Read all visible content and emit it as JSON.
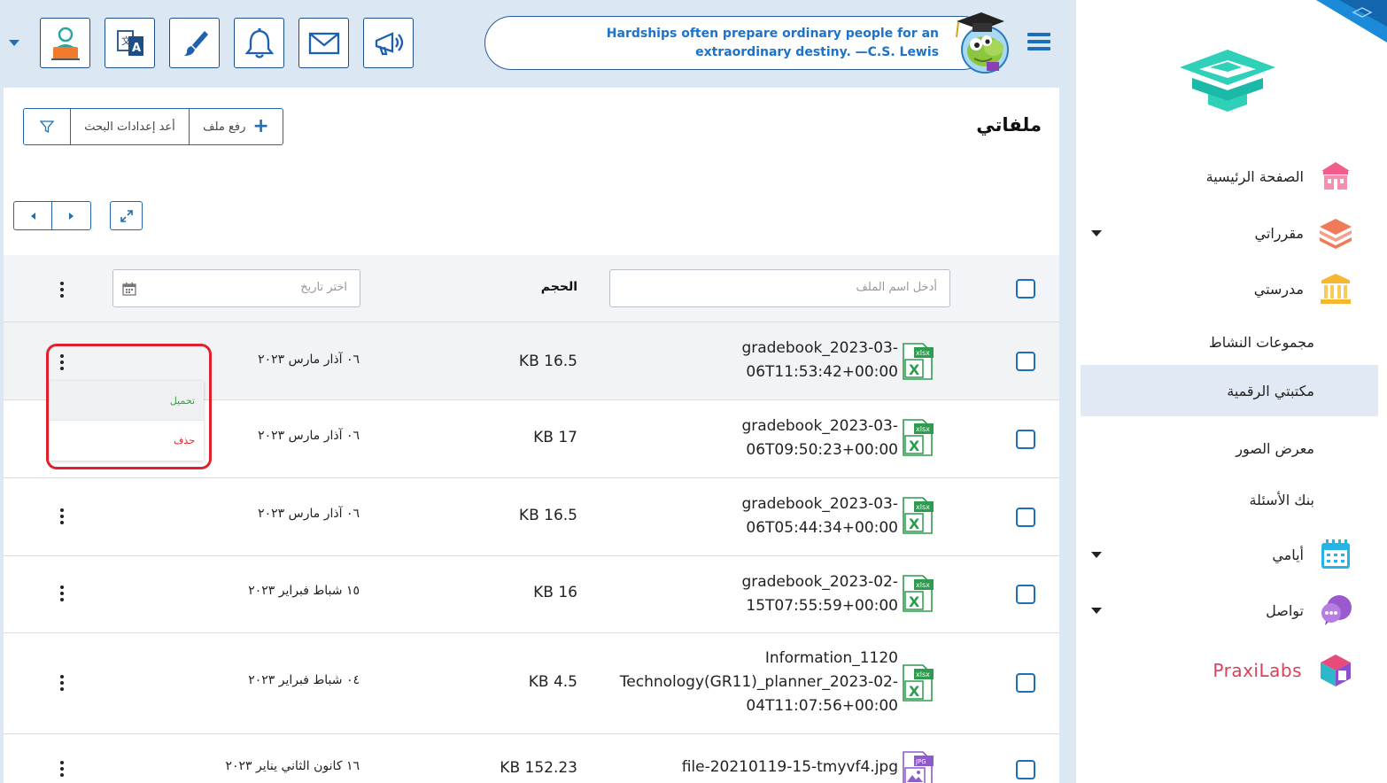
{
  "topbar": {
    "quote": "Hardships often prepare ordinary people for an extraordinary destiny. —C.S. Lewis",
    "buttons": [
      "profile-icon",
      "translate-icon",
      "brush-icon",
      "bell-icon",
      "mail-icon",
      "megaphone-icon"
    ]
  },
  "sidebar": {
    "items": [
      {
        "label": "الصفحة الرئيسية",
        "icon": "school-building-icon"
      },
      {
        "label": "مقرراتي",
        "icon": "books-stack-icon"
      },
      {
        "label": "مدرستي",
        "icon": "institution-icon"
      },
      {
        "label": "مجموعات النشاط"
      },
      {
        "label": "مكتبتي الرقمية",
        "active": true
      },
      {
        "label": "معرض الصور"
      },
      {
        "label": "بنك الأسئلة"
      },
      {
        "label": "أيامي",
        "icon": "calendar-icon"
      },
      {
        "label": "تواصل",
        "icon": "chat-bubbles-icon"
      }
    ],
    "praxilabs": "PraxiLabs"
  },
  "main": {
    "title": "ملفاتي",
    "upload_label": "رفع ملف",
    "reset_label": "أعد إعدادات البحث"
  },
  "table": {
    "name_placeholder": "أدخل اسم الملف",
    "size_header": "الحجم",
    "date_placeholder": "اختر تاريخ",
    "rows": [
      {
        "name_line1": "gradebook_2023-03-",
        "name_line2": "06T11:53:42+00:00",
        "type": "xlsx",
        "size": "KB 16.5",
        "date": "٠٦ آذار مارس ٢٠٢٣"
      },
      {
        "name_line1": "gradebook_2023-03-",
        "name_line2": "06T09:50:23+00:00",
        "type": "xlsx",
        "size": "KB 17",
        "date": "٠٦ آذار مارس ٢٠٢٣"
      },
      {
        "name_line1": "gradebook_2023-03-",
        "name_line2": "06T05:44:34+00:00",
        "type": "xlsx",
        "size": "KB 16.5",
        "date": "٠٦ آذار مارس ٢٠٢٣"
      },
      {
        "name_line1": "gradebook_2023-02-",
        "name_line2": "15T07:55:59+00:00",
        "type": "xlsx",
        "size": "KB 16",
        "date": "١٥ شباط فبراير ٢٠٢٣"
      },
      {
        "name_line1": "Information_1120",
        "name_line2": "Technology(GR11)_planner_2023-02-",
        "name_line3": "04T11:07:56+00:00",
        "type": "xlsx",
        "size": "KB 4.5",
        "date": "٠٤ شباط فبراير ٢٠٢٣"
      },
      {
        "name_line1": "file-20210119-15-tmyvf4.jpg",
        "type": "jpg",
        "size": "KB 152.23",
        "date": "١٦ كانون الثاني يناير ٢٠٢٣"
      }
    ],
    "menu": {
      "download": "تحميل",
      "delete": "حذف"
    },
    "xlsx_badge": "xlsx",
    "jpg_badge": "JPG"
  }
}
